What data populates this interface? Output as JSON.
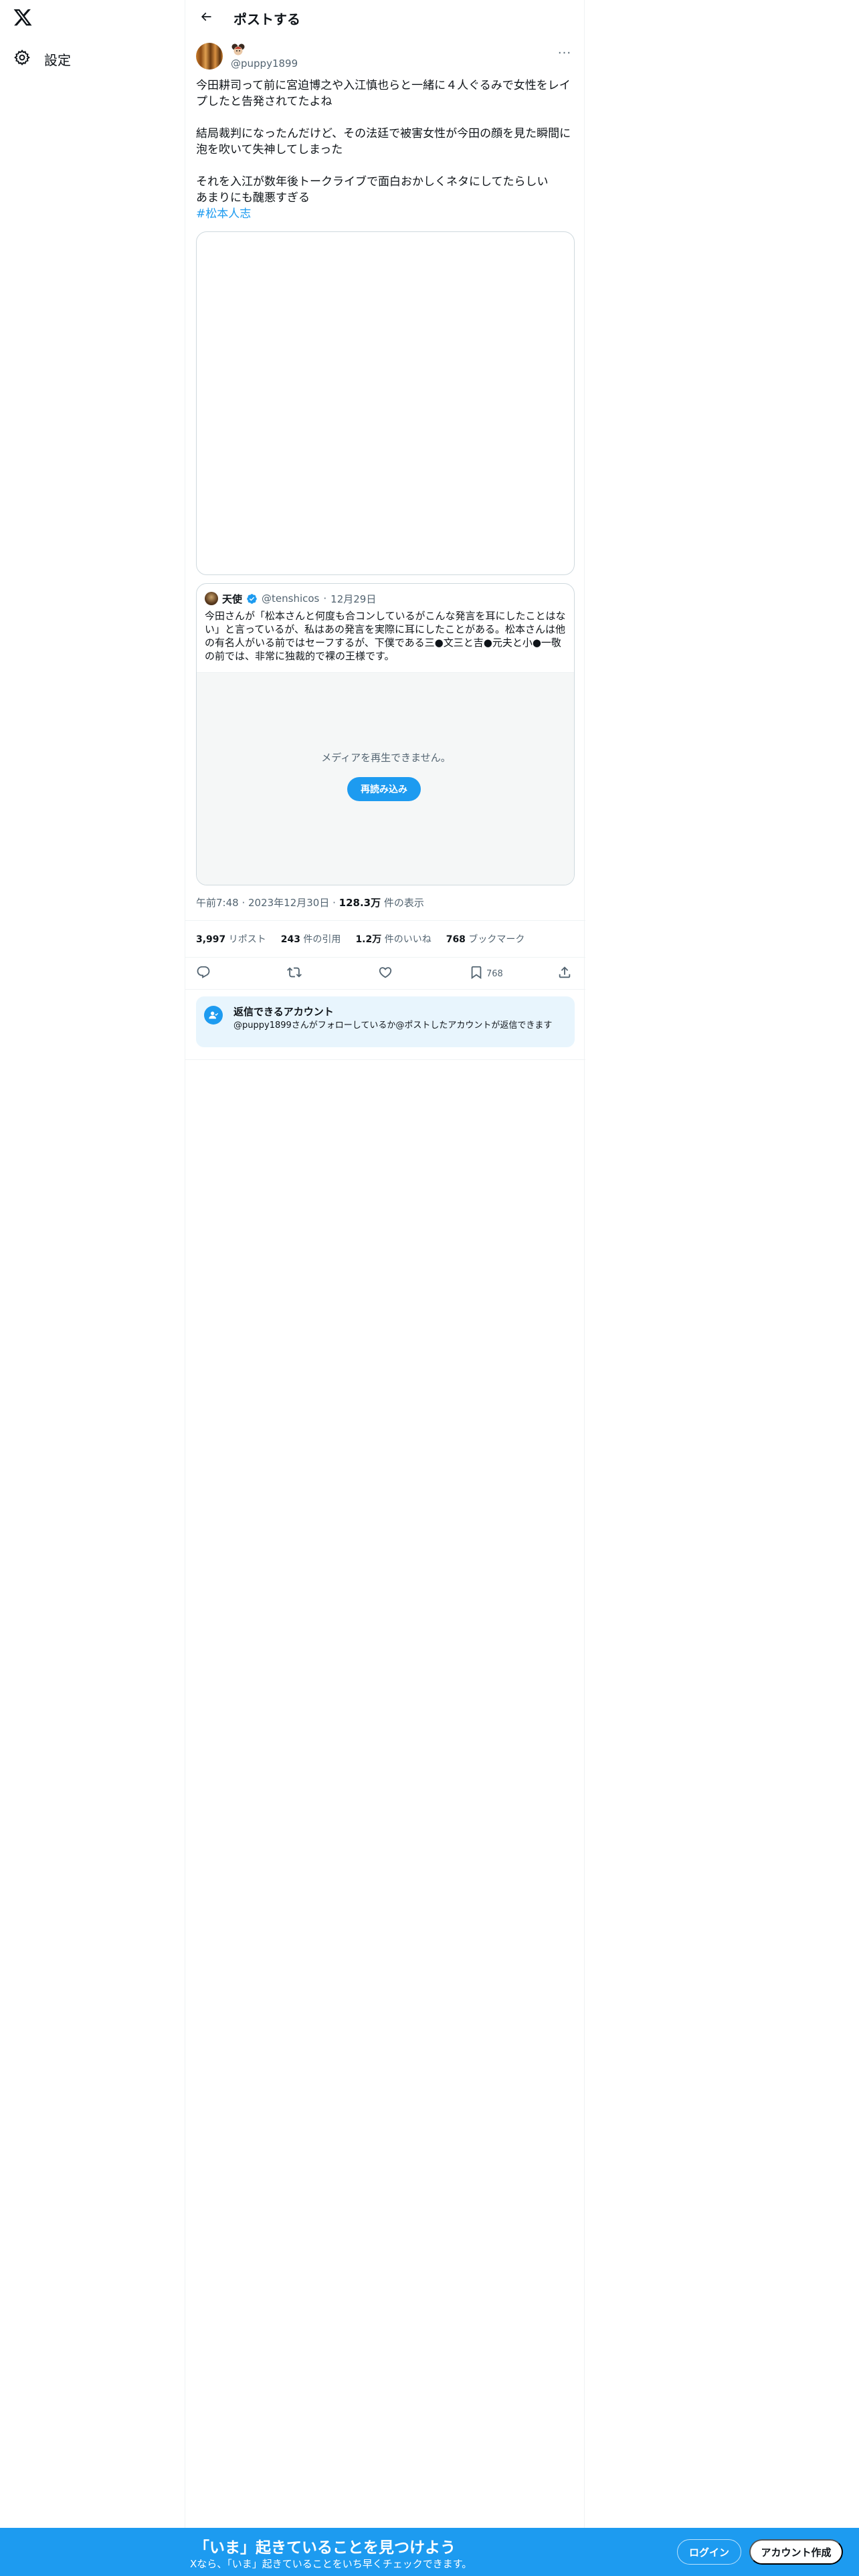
{
  "sidebar": {
    "logo": "x-logo-icon",
    "settings_label": "設定",
    "settings_icon": "gear-icon"
  },
  "header": {
    "back_icon": "arrow-left-icon",
    "title": "ポストする"
  },
  "post": {
    "handle": "@puppy1899",
    "more_label": "···",
    "text_lines": [
      "今田耕司って前に宮迫博之や入江慎也らと一緒に４人ぐるみで女性をレイ",
      "プしたと告発されてたよね",
      "",
      "結局裁判になったんだけど、その法廷で被害女性が今田の顔を見た瞬間に",
      "泡を吹いて失神してしまった",
      "",
      "それを入江が数年後トークライブで面白おかしくネタにしてたらしい",
      "あまりにも醜悪すぎる"
    ],
    "hashtag": "#松本人志",
    "time": "午前7:48 · 2023年12月30日 · ",
    "views_num": "128.3万",
    "views_label": " 件の表示"
  },
  "quote": {
    "name": "天使",
    "handle": "@tenshicos",
    "dot": "·",
    "date": "12月29日",
    "text": "今田さんが「松本さんと何度も合コンしているがこんな発言を耳にしたことはない」と言っているが、私はあの発言を実際に耳にしたことがある。松本さんは他の有名人がいる前ではセーフするが、下僕である三●文三と吉●元夫と小●一敬の前では、非常に独裁的で裸の王様です。",
    "media_message": "メディアを再生できません。",
    "reload_label": "再読み込み"
  },
  "stats": {
    "reposts_num": "3,997",
    "reposts_label": " リポスト",
    "quotes_num": "243",
    "quotes_label": " 件の引用",
    "likes_num": "1.2万",
    "likes_label": " 件のいいね",
    "bookmarks_num": "768",
    "bookmarks_label": " ブックマーク"
  },
  "actions": {
    "reply_icon": "reply-icon",
    "repost_icon": "repost-icon",
    "like_icon": "heart-icon",
    "bookmark_icon": "bookmark-icon",
    "bookmark_count": "768",
    "share_icon": "share-icon"
  },
  "reply_info": {
    "title": "返信できるアカウント",
    "description": "@puppy1899さんがフォローしているか@ポストしたアカウントが返信できます"
  },
  "bottom_bar": {
    "title": "「いま」起きていることを見つけよう",
    "subtitle": "Xなら、「いま」起きていることをいち早くチェックできます。",
    "login_label": "ログイン",
    "signup_label": "アカウント作成"
  },
  "colors": {
    "accent": "#1d9bf0",
    "text": "#0f1419",
    "secondary": "#536471",
    "border": "#cfd9de"
  }
}
